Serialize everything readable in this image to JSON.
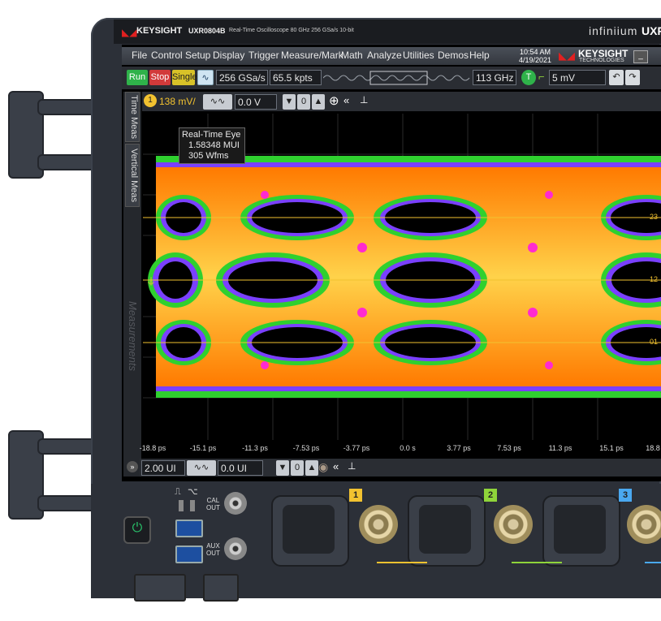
{
  "brand": {
    "logo_text": "KEYSIGHT",
    "model": "UXR0804B",
    "model_desc": "Real-Time Oscilloscope  80 GHz  256 GSa/s  10-bit",
    "series": "infiniium",
    "series_suffix": "UXR",
    "screen_logo": "KEYSIGHT",
    "screen_logo_sub": "TECHNOLOGIES"
  },
  "menu": {
    "items": [
      "File",
      "Control",
      "Setup",
      "Display",
      "Trigger",
      "Measure/Mark",
      "Math",
      "Analyze",
      "Utilities",
      "Demos",
      "Help"
    ],
    "time": "10:54 AM",
    "date": "4/19/2021"
  },
  "toolbar": {
    "run": "Run",
    "stop": "Stop",
    "single": "Single",
    "sample_rate": "256 GSa/s",
    "memory_depth": "65.5 kpts",
    "bandwidth": "113 GHz",
    "trigger_level": "5 mV",
    "trigger_label": "T"
  },
  "vertical": {
    "channel": "1",
    "scale": "138 mV/",
    "offset": "0.0 V"
  },
  "sidetabs": {
    "time_meas": "Time Meas",
    "vertical_meas": "Vertical Meas",
    "measurements": "Measurements"
  },
  "eye": {
    "title": "Real-Time Eye",
    "ui": "1.58348 MUI",
    "wfms": "305 Wfms",
    "levels": [
      "23",
      "12",
      "01"
    ]
  },
  "xaxis": {
    "ticks": [
      "-18.8 ps",
      "-15.1 ps",
      "-11.3 ps",
      "-7.53 ps",
      "-3.77 ps",
      "0.0 s",
      "3.77 ps",
      "7.53 ps",
      "11.3 ps",
      "15.1 ps",
      "18.8"
    ]
  },
  "horizontal": {
    "scale": "2.00 UI",
    "position": "0.0 UI"
  },
  "panel": {
    "cal_out": "CAL\nOUT",
    "aux_out": "AUX\nOUT",
    "channels": [
      "1",
      "2",
      "3"
    ],
    "channel_colors": [
      "#f2c230",
      "#8fd43a",
      "#4aa8f0"
    ]
  },
  "colors": {
    "run": "#2fb24a",
    "stop": "#d23a3a",
    "single": "#d8c228",
    "power": "#29c26a"
  }
}
